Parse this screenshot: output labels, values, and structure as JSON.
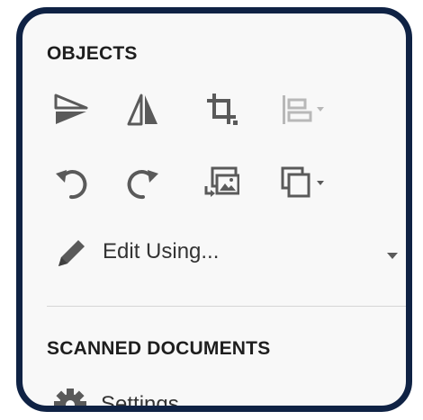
{
  "edge_text": "e",
  "panel": {
    "objects_heading": "OBJECTS",
    "tools": [
      {
        "icon": "flip-horizontal-triangle-icon"
      },
      {
        "icon": "mirror-vertical-icon"
      },
      {
        "icon": "crop-icon"
      },
      {
        "icon": "align-objects-dropdown-icon",
        "disabled": true
      },
      {
        "icon": "rotate-counterclockwise-icon"
      },
      {
        "icon": "rotate-clockwise-icon"
      },
      {
        "icon": "replace-image-icon"
      },
      {
        "icon": "arrange-dropdown-icon"
      }
    ],
    "edit_using_label": "Edit Using...",
    "scanned_heading": "SCANNED DOCUMENTS",
    "settings_label": "Settings"
  },
  "colors": {
    "frame": "#0f2244",
    "panel_bg": "#f8f8f8",
    "icon": "#5a5a5a",
    "icon_disabled": "#b8b8b8",
    "text": "#1e1e1e"
  }
}
